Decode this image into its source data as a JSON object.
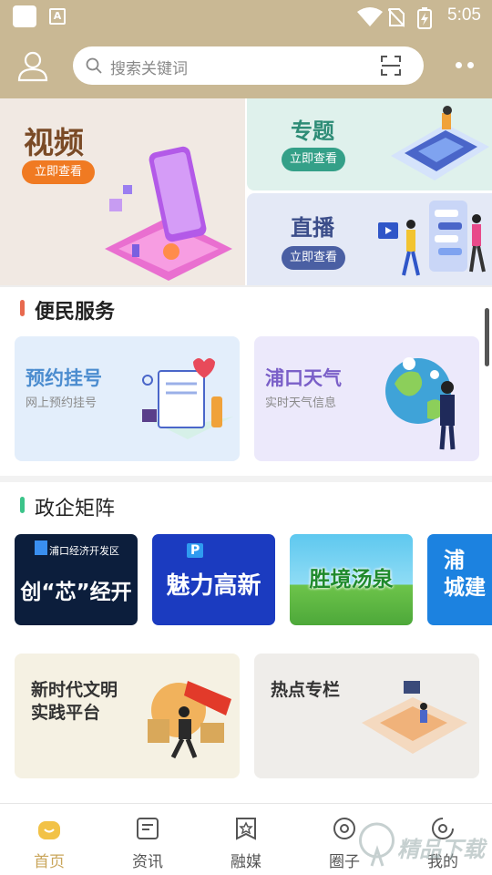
{
  "status_bar": {
    "time": "5:05",
    "app_icon_letter": "A"
  },
  "header": {
    "search_placeholder": "搜索关键词",
    "avatar_icon": "user-icon",
    "scan_icon": "scan-icon",
    "more_icon": "more-dots-icon"
  },
  "banners": {
    "video": {
      "title": "视频",
      "button": "立即查看"
    },
    "topic": {
      "title": "专题",
      "button": "立即查看"
    },
    "live": {
      "title": "直播",
      "button": "立即查看"
    }
  },
  "services": {
    "title": "便民服务",
    "accent": "#e86a4f",
    "items": [
      {
        "title": "预约挂号",
        "subtitle": "网上预约挂号"
      },
      {
        "title": "浦口天气",
        "subtitle": "实时天气信息"
      }
    ]
  },
  "matrix": {
    "title": "政企矩阵",
    "accent": "#3cc48a",
    "tiles": [
      {
        "badge": "浦口经济开发区",
        "title": "创“芯”经开"
      },
      {
        "badge": "P",
        "title": "魅力高新"
      },
      {
        "title": "胜境汤泉"
      },
      {
        "title": "浦\n城建"
      }
    ],
    "features": [
      {
        "title": "新时代文明\n实践平台"
      },
      {
        "title": "热点专栏"
      }
    ]
  },
  "nav": {
    "items": [
      {
        "label": "首页",
        "icon": "home-icon",
        "active": true
      },
      {
        "label": "资讯",
        "icon": "news-icon",
        "active": false
      },
      {
        "label": "融媒",
        "icon": "media-icon",
        "active": false
      },
      {
        "label": "圈子",
        "icon": "circle-icon",
        "active": false
      },
      {
        "label": "我的",
        "icon": "profile-icon",
        "active": false
      }
    ]
  },
  "watermark": "精品下载",
  "colors": {
    "header_bg": "#c9b894",
    "active_nav": "#c9a55a"
  }
}
